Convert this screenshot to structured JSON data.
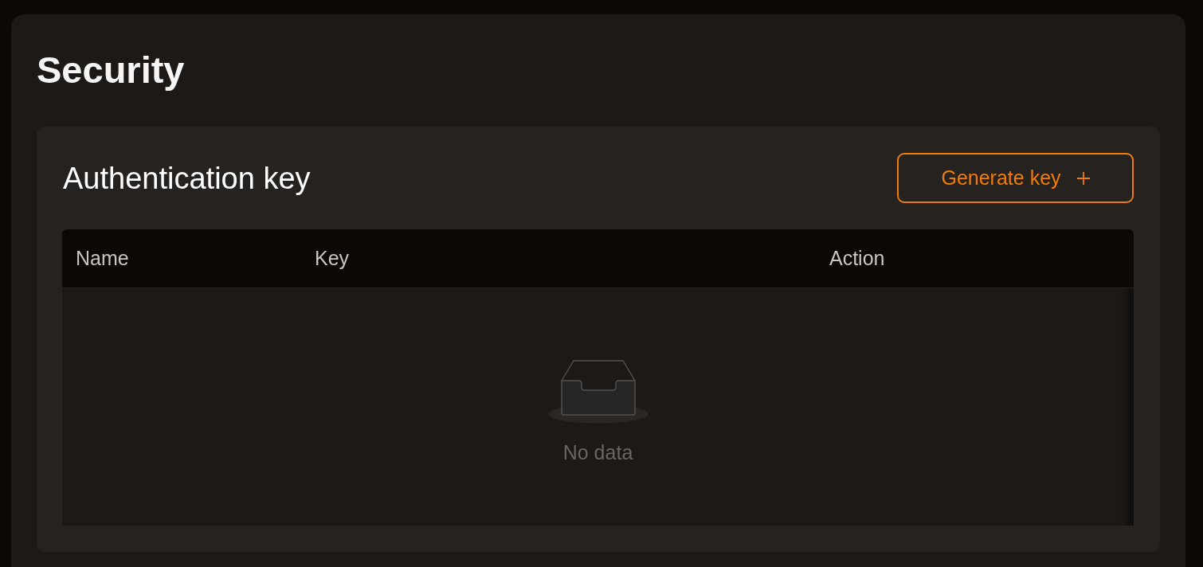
{
  "page": {
    "title": "Security"
  },
  "auth_card": {
    "title": "Authentication key",
    "button": {
      "label": "Generate key"
    },
    "table": {
      "columns": [
        "Name",
        "Key",
        "Action"
      ],
      "empty_text": "No data"
    }
  }
}
